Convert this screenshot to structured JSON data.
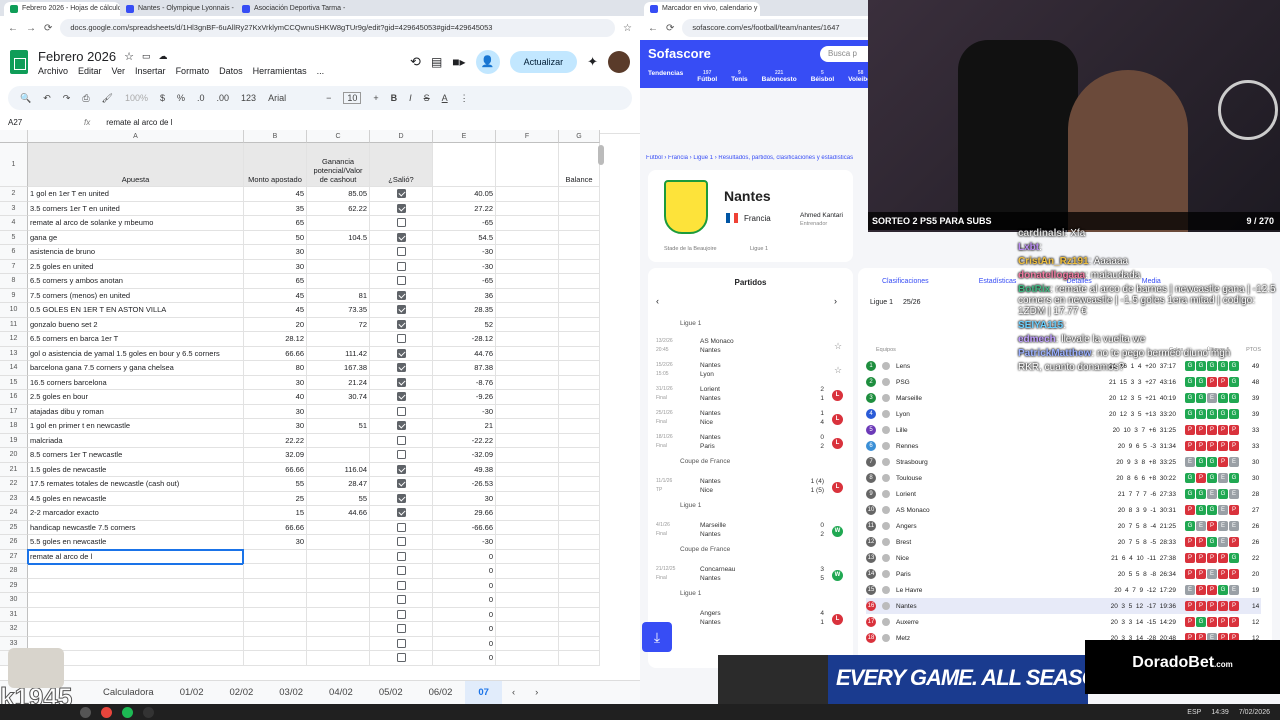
{
  "browser_left": {
    "tabs": [
      {
        "label": "Febrero 2026 - Hojas de cálculo",
        "color": "#0f9d58"
      },
      {
        "label": "Nantes - Olympique Lyonnais -",
        "color": "#374df5"
      },
      {
        "label": "Asociación Deportiva Tarma -",
        "color": "#374df5"
      }
    ],
    "url": "docs.google.com/spreadsheets/d/1Hl3gnBF-6uAllRy27KxVrklymCCQwnuSHKW8gTUr9g/edit?gid=429645053#gid=429645053"
  },
  "sheets": {
    "doc_title": "Febrero 2026",
    "menus": [
      "Archivo",
      "Editar",
      "Ver",
      "Insertar",
      "Formato",
      "Datos",
      "Herramientas",
      "..."
    ],
    "update_button": "Actualizar",
    "zoom": "100%",
    "font": "Arial",
    "font_size": "10",
    "cell_ref": "A27",
    "formula": "remate al arco de l",
    "col_letters": [
      "A",
      "B",
      "C",
      "D",
      "E",
      "F",
      "G"
    ],
    "headers": {
      "a": "Apuesta",
      "b": "Monto apostado",
      "c": "Ganancia potencial/Valor de cashout",
      "d": "¿Salió?",
      "g": "Balance"
    },
    "rows": [
      {
        "n": "2",
        "a": "1 gol en 1er T en united",
        "b": "45",
        "c": "85.05",
        "d": true,
        "e": "40.05"
      },
      {
        "n": "3",
        "a": "3.5 corners 1er T en united",
        "b": "35",
        "c": "62.22",
        "d": true,
        "e": "27.22"
      },
      {
        "n": "4",
        "a": "remate al arco de solanke y mbeumo",
        "b": "65",
        "c": "",
        "d": false,
        "e": "-65"
      },
      {
        "n": "5",
        "a": "gana ge",
        "b": "50",
        "c": "104.5",
        "d": true,
        "e": "54.5"
      },
      {
        "n": "6",
        "a": "asistencia de bruno",
        "b": "30",
        "c": "",
        "d": false,
        "e": "-30"
      },
      {
        "n": "7",
        "a": "2.5 goles en united",
        "b": "30",
        "c": "",
        "d": false,
        "e": "-30"
      },
      {
        "n": "8",
        "a": "6.5 corners y ambos anotan",
        "b": "65",
        "c": "",
        "d": false,
        "e": "-65"
      },
      {
        "n": "9",
        "a": "7.5 corners (menos) en united",
        "b": "45",
        "c": "81",
        "d": true,
        "e": "36"
      },
      {
        "n": "10",
        "a": "0.5 GOLES EN 1ER T EN ASTON VILLA",
        "b": "45",
        "c": "73.35",
        "d": true,
        "e": "28.35"
      },
      {
        "n": "11",
        "a": "gonzalo bueno set 2",
        "b": "20",
        "c": "72",
        "d": true,
        "e": "52"
      },
      {
        "n": "12",
        "a": "6.5 corners en barca 1er T",
        "b": "28.12",
        "c": "",
        "d": false,
        "e": "-28.12"
      },
      {
        "n": "13",
        "a": "gol o asistencia de yamal 1.5 goles en bour y 6.5 corners",
        "b": "66.66",
        "c": "111.42",
        "d": true,
        "e": "44.76"
      },
      {
        "n": "14",
        "a": "barcelona gana 7.5 corners y gana chelsea",
        "b": "80",
        "c": "167.38",
        "d": true,
        "e": "87.38"
      },
      {
        "n": "15",
        "a": "16.5 corners barcelona",
        "b": "30",
        "c": "21.24",
        "d": true,
        "e": "-8.76"
      },
      {
        "n": "16",
        "a": "2.5 goles en bour",
        "b": "40",
        "c": "30.74",
        "d": true,
        "e": "-9.26"
      },
      {
        "n": "17",
        "a": "atajadas dibu y roman",
        "b": "30",
        "c": "",
        "d": false,
        "e": "-30"
      },
      {
        "n": "18",
        "a": "1 gol en primer t en newcastle",
        "b": "30",
        "c": "51",
        "d": true,
        "e": "21"
      },
      {
        "n": "19",
        "a": "malcriada",
        "b": "22.22",
        "c": "",
        "d": false,
        "e": "-22.22"
      },
      {
        "n": "20",
        "a": "8.5 corners 1er T newcastle",
        "b": "32.09",
        "c": "",
        "d": false,
        "e": "-32.09"
      },
      {
        "n": "21",
        "a": "1.5 goles de newcastle",
        "b": "66.66",
        "c": "116.04",
        "d": true,
        "e": "49.38"
      },
      {
        "n": "22",
        "a": "17.5 remates totales de newcastle (cash out)",
        "b": "55",
        "c": "28.47",
        "d": true,
        "e": "-26.53"
      },
      {
        "n": "23",
        "a": "4.5 goles en newcastle",
        "b": "25",
        "c": "55",
        "d": true,
        "e": "30"
      },
      {
        "n": "24",
        "a": "2-2 marcador exacto",
        "b": "15",
        "c": "44.66",
        "d": true,
        "e": "29.66"
      },
      {
        "n": "25",
        "a": "handicap newcastle 7.5 corners",
        "b": "66.66",
        "c": "",
        "d": false,
        "e": "-66.66"
      },
      {
        "n": "26",
        "a": "5.5 goles en newcastle",
        "b": "30",
        "c": "",
        "d": false,
        "e": "-30"
      },
      {
        "n": "27",
        "a": "remate al arco de l",
        "b": "",
        "c": "",
        "d": false,
        "e": "0"
      },
      {
        "n": "28",
        "a": "",
        "b": "",
        "c": "",
        "d": false,
        "e": "0"
      },
      {
        "n": "29",
        "a": "",
        "b": "",
        "c": "",
        "d": false,
        "e": "0"
      },
      {
        "n": "30",
        "a": "",
        "b": "",
        "c": "",
        "d": false,
        "e": "0"
      },
      {
        "n": "31",
        "a": "",
        "b": "",
        "c": "",
        "d": false,
        "e": "0"
      },
      {
        "n": "32",
        "a": "",
        "b": "",
        "c": "",
        "d": false,
        "e": "0"
      },
      {
        "n": "33",
        "a": "",
        "b": "",
        "c": "",
        "d": false,
        "e": "0"
      },
      {
        "n": "34",
        "a": "",
        "b": "",
        "c": "",
        "d": false,
        "e": "0"
      }
    ],
    "tabs": [
      "Calculadora",
      "01/02",
      "02/02",
      "03/02",
      "04/02",
      "05/02",
      "06/02",
      "07"
    ],
    "active_tab": "07"
  },
  "browser_right": {
    "tab": "Marcador en vivo, calendario y",
    "url": "sofascore.com/es/football/team/nantes/1647"
  },
  "sofascore": {
    "brand": "Sofascore",
    "search": "Busca p",
    "sports": [
      {
        "label": "Tendencias",
        "count": ""
      },
      {
        "label": "Fútbol",
        "count": "197"
      },
      {
        "label": "Tenis",
        "count": "9"
      },
      {
        "label": "Baloncesto",
        "count": "221"
      },
      {
        "label": "Béisbol",
        "count": "5"
      },
      {
        "label": "Voleibol",
        "count": "58"
      }
    ],
    "breadcrumb": "Fútbol › Francia › Ligue 1 › Resultados, partidos, clasificaciones y estadísticas",
    "team": "Nantes",
    "country": "Francia",
    "coach": "Ahmed Kantari",
    "coach_role": "Entrenador",
    "stadium": "Stade de la Beaujoire",
    "league": "Ligue 1",
    "matches_title": "Partidos",
    "comp_ligue": "Ligue 1",
    "comp_coupe": "Coupe de France",
    "matches": [
      {
        "date": "13/2/26",
        "time": "20:45",
        "home": "AS Monaco",
        "away": "Nantes",
        "sh": "",
        "sa": "",
        "res": ""
      },
      {
        "date": "15/2/26",
        "time": "15:05",
        "home": "Nantes",
        "away": "Lyon",
        "sh": "",
        "sa": "",
        "res": ""
      },
      {
        "date": "31/1/26",
        "time": "Final",
        "home": "Lorient",
        "away": "Nantes",
        "sh": "2",
        "sa": "1",
        "res": "L"
      },
      {
        "date": "25/1/26",
        "time": "Final",
        "home": "Nantes",
        "away": "Nice",
        "sh": "1",
        "sa": "4",
        "res": "L"
      },
      {
        "date": "18/1/26",
        "time": "Final",
        "home": "Nantes",
        "away": "Paris",
        "sh": "0",
        "sa": "2",
        "res": "L"
      },
      {
        "date": "11/1/26",
        "time": "TP",
        "home": "Nantes",
        "away": "Nice",
        "sh": "1 (4)",
        "sa": "1 (5)",
        "res": "L"
      },
      {
        "date": "4/1/26",
        "time": "Final",
        "home": "Marseille",
        "away": "Nantes",
        "sh": "0",
        "sa": "2",
        "res": "W"
      },
      {
        "date": "21/12/25",
        "time": "Final",
        "home": "Concarneau",
        "away": "Nantes",
        "sh": "3",
        "sa": "5",
        "res": "W"
      },
      {
        "date": "",
        "time": "",
        "home": "Angers",
        "away": "Nantes",
        "sh": "4",
        "sa": "1",
        "res": "L"
      }
    ],
    "standings_tabs": [
      "Clasificaciones",
      "Estadísticas",
      "Detalles",
      "Media"
    ],
    "season": "25/26",
    "filters": [
      "Todos",
      "Local",
      "Visitante"
    ],
    "cols": [
      "Equipos",
      "Goles",
      "Últimos 5",
      "PTOS"
    ],
    "standings": [
      {
        "p": "1",
        "t": "Lens",
        "s": "21  16  1  4  +20  37:17",
        "f": [
          "G",
          "G",
          "G",
          "G",
          "G"
        ],
        "pts": "49"
      },
      {
        "p": "2",
        "t": "PSG",
        "s": "21  15  3  3  +27  43:16",
        "f": [
          "G",
          "G",
          "P",
          "P",
          "G"
        ],
        "pts": "48"
      },
      {
        "p": "3",
        "t": "Marseille",
        "s": "20  12  3  5  +21  40:19",
        "f": [
          "G",
          "G",
          "E",
          "G",
          "G"
        ],
        "pts": "39"
      },
      {
        "p": "4",
        "t": "Lyon",
        "s": "20  12  3  5  +13  33:20",
        "f": [
          "G",
          "G",
          "G",
          "G",
          "G"
        ],
        "pts": "39"
      },
      {
        "p": "5",
        "t": "Lille",
        "s": "20  10  3  7  +6  31:25",
        "f": [
          "P",
          "P",
          "P",
          "P",
          "P"
        ],
        "pts": "33"
      },
      {
        "p": "6",
        "t": "Rennes",
        "s": "20  9  6  5  -3  31:34",
        "f": [
          "P",
          "P",
          "P",
          "P",
          "P"
        ],
        "pts": "33"
      },
      {
        "p": "7",
        "t": "Strasbourg",
        "s": "20  9  3  8  +8  33:25",
        "f": [
          "E",
          "G",
          "G",
          "P",
          "E"
        ],
        "pts": "30"
      },
      {
        "p": "8",
        "t": "Toulouse",
        "s": "20  8  6  6  +8  30:22",
        "f": [
          "G",
          "P",
          "G",
          "E",
          "G"
        ],
        "pts": "30"
      },
      {
        "p": "9",
        "t": "Lorient",
        "s": "21  7  7  7  -6  27:33",
        "f": [
          "G",
          "G",
          "E",
          "G",
          "E"
        ],
        "pts": "28"
      },
      {
        "p": "10",
        "t": "AS Monaco",
        "s": "20  8  3  9  -1  30:31",
        "f": [
          "P",
          "G",
          "G",
          "E",
          "P"
        ],
        "pts": "27"
      },
      {
        "p": "11",
        "t": "Angers",
        "s": "20  7  5  8  -4  21:25",
        "f": [
          "G",
          "E",
          "P",
          "E",
          "E"
        ],
        "pts": "26"
      },
      {
        "p": "12",
        "t": "Brest",
        "s": "20  7  5  8  -5  28:33",
        "f": [
          "P",
          "P",
          "G",
          "E",
          "P"
        ],
        "pts": "26"
      },
      {
        "p": "13",
        "t": "Nice",
        "s": "21  6  4  10  -11  27:38",
        "f": [
          "P",
          "P",
          "P",
          "P",
          "G"
        ],
        "pts": "22"
      },
      {
        "p": "14",
        "t": "Paris",
        "s": "20  5  5  8  -8  26:34",
        "f": [
          "P",
          "P",
          "E",
          "P",
          "P"
        ],
        "pts": "20"
      },
      {
        "p": "15",
        "t": "Le Havre",
        "s": "20  4  7  9  -12  17:29",
        "f": [
          "E",
          "P",
          "P",
          "G",
          "E"
        ],
        "pts": "19"
      },
      {
        "p": "16",
        "t": "Nantes",
        "s": "20  3  5  12  -17  19:36",
        "f": [
          "P",
          "P",
          "P",
          "P",
          "P"
        ],
        "pts": "14"
      },
      {
        "p": "17",
        "t": "Auxerre",
        "s": "20  3  3  14  -15  14:29",
        "f": [
          "P",
          "G",
          "P",
          "P",
          "P"
        ],
        "pts": "12"
      },
      {
        "p": "18",
        "t": "Metz",
        "s": "20  3  3  14  -28  20:48",
        "f": [
          "P",
          "P",
          "E",
          "P",
          "P"
        ],
        "pts": "12"
      }
    ]
  },
  "stream": {
    "banner": "SORTEO 2 PS5 PARA SUBS",
    "counter": "9 / 270",
    "watermark": "k1945",
    "chat": [
      {
        "u": "cardinalsi",
        "m": ": Xfa"
      },
      {
        "u": "Lxbt",
        "m": ": "
      },
      {
        "u": "CristAn_Rz191",
        "m": ": Aaaaaa"
      },
      {
        "u": "donatellogaaa",
        "m": ": malaudada"
      },
      {
        "u": "BotRix",
        "m": ": remate al arco de barnes | newcastle gana | -12.5 corners en newcastle | -1.5 goles 1era mitad | codigo: 1ZDM | 17.77 €"
      },
      {
        "u": "SEIYA115",
        "m": ": "
      },
      {
        "u": "edmech",
        "m": ": llevale la vuelta we"
      },
      {
        "u": "PatrickMatthew",
        "m": ": no te pego bermeo diuno mgn"
      },
      {
        "u": "",
        "m": "RKR, cuanto donamos?"
      }
    ],
    "ad": "EVERY GAME. ALL SEASON. ALL HE",
    "sponsor": "DoradoBet",
    "sponsor_sub": ".com"
  },
  "taskbar": {
    "lang": "ESP",
    "time": "14:39",
    "date": "7/02/2026"
  },
  "colors": {
    "sheets_green": "#0f9d58",
    "sofascore_blue": "#374df5",
    "win": "#20a852",
    "loss": "#d9323c",
    "draw": "#9aa0a6"
  }
}
